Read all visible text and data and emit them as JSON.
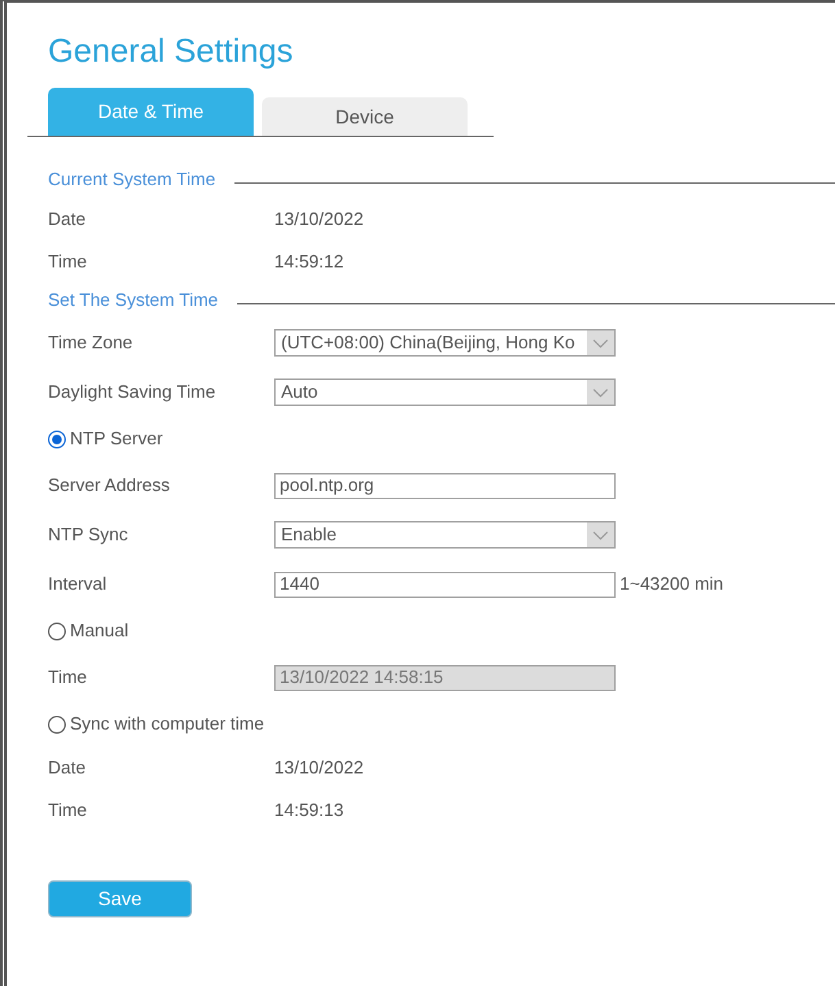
{
  "title": "General Settings",
  "tabs": [
    {
      "label": "Date & Time",
      "selected": true
    },
    {
      "label": "Device",
      "selected": false
    }
  ],
  "rows": [
    {
      "kind": "section",
      "label": "Current System Time"
    },
    {
      "kind": "info",
      "label": "Date",
      "value": "13/10/2022"
    },
    {
      "kind": "info",
      "label": "Time",
      "value": "14:59:12"
    },
    {
      "kind": "section",
      "label": "Set The System Time"
    },
    {
      "kind": "select",
      "label": "Time Zone",
      "value": "(UTC+08:00) China(Beijing, Hong Ko"
    },
    {
      "kind": "select",
      "label": "Daylight Saving Time",
      "value": "Auto"
    },
    {
      "kind": "radio",
      "label": "NTP Server",
      "selected": true
    },
    {
      "kind": "input",
      "label": "Server Address",
      "value": "pool.ntp.org",
      "disabled": false
    },
    {
      "kind": "select",
      "label": "NTP Sync",
      "value": "Enable"
    },
    {
      "kind": "input",
      "label": "Interval",
      "value": "1440",
      "suffix": "1~43200 min",
      "disabled": false
    },
    {
      "kind": "radio",
      "label": "Manual",
      "selected": false
    },
    {
      "kind": "input",
      "label": "Time",
      "value": "13/10/2022 14:58:15",
      "disabled": true
    },
    {
      "kind": "radio",
      "label": "Sync with computer time",
      "selected": false
    },
    {
      "kind": "info",
      "label": "Date",
      "value": "13/10/2022"
    },
    {
      "kind": "info",
      "label": "Time",
      "value": "14:59:13"
    }
  ],
  "save_button": "Save"
}
